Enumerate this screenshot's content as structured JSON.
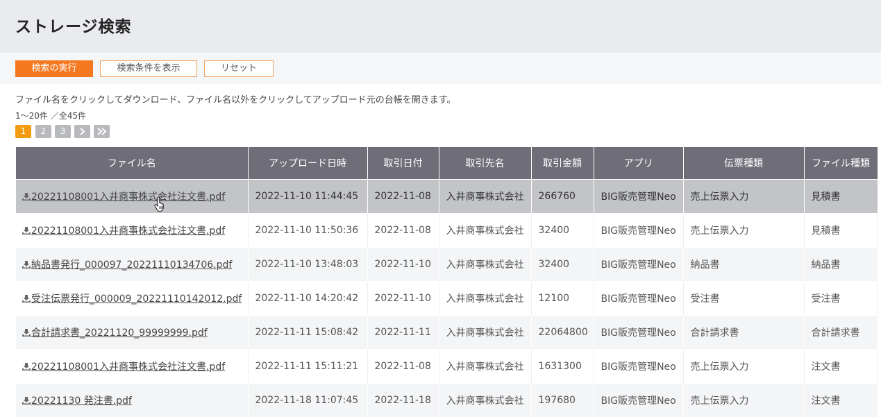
{
  "page": {
    "title": "ストレージ検索"
  },
  "toolbar": {
    "execute_label": "検索の実行",
    "show_conditions_label": "検索条件を表示",
    "reset_label": "リセット"
  },
  "description": "ファイル名をクリックしてダウンロード、ファイル名以外をクリックしてアップロード元の台帳を開きます。",
  "result_count": "1〜20件 ／全45件",
  "pagination": {
    "pages": [
      "1",
      "2",
      "3"
    ],
    "current": "1",
    "next_icon": "chevron-right-icon",
    "last_icon": "double-chevron-right-icon"
  },
  "table": {
    "columns": [
      "ファイル名",
      "アップロード日時",
      "取引日付",
      "取引先名",
      "取引金額",
      "アプリ",
      "伝票種類",
      "ファイル種類"
    ],
    "rows": [
      {
        "file": "20221108001入井商事株式会社注文書.pdf",
        "uploaded": "2022-11-10 11:44:45",
        "date": "2022-11-08",
        "partner": "入井商事株式会社",
        "amount": "266760",
        "app": "BIG販売管理Neo",
        "slip": "売上伝票入力",
        "ftype": "見積書"
      },
      {
        "file": "20221108001入井商事株式会社注文書.pdf",
        "uploaded": "2022-11-10 11:50:36",
        "date": "2022-11-08",
        "partner": "入井商事株式会社",
        "amount": "32400",
        "app": "BIG販売管理Neo",
        "slip": "売上伝票入力",
        "ftype": "見積書"
      },
      {
        "file": "納品書発行_000097_20221110134706.pdf",
        "uploaded": "2022-11-10 13:48:03",
        "date": "2022-11-10",
        "partner": "入井商事株式会社",
        "amount": "32400",
        "app": "BIG販売管理Neo",
        "slip": "納品書",
        "ftype": "納品書"
      },
      {
        "file": "受注伝票発行_000009_20221110142012.pdf",
        "uploaded": "2022-11-10 14:20:42",
        "date": "2022-11-10",
        "partner": "入井商事株式会社",
        "amount": "12100",
        "app": "BIG販売管理Neo",
        "slip": "受注書",
        "ftype": "受注書"
      },
      {
        "file": "合計請求書_20221120_99999999.pdf",
        "uploaded": "2022-11-11 15:08:42",
        "date": "2022-11-11",
        "partner": "入井商事株式会社",
        "amount": "22064800",
        "app": "BIG販売管理Neo",
        "slip": "合計請求書",
        "ftype": "合計請求書"
      },
      {
        "file": "20221108001入井商事株式会社注文書.pdf",
        "uploaded": "2022-11-11 15:11:21",
        "date": "2022-11-08",
        "partner": "入井商事株式会社",
        "amount": "1631300",
        "app": "BIG販売管理Neo",
        "slip": "売上伝票入力",
        "ftype": "注文書"
      },
      {
        "file": "20221130 発注書.pdf",
        "uploaded": "2022-11-18 11:07:45",
        "date": "2022-11-18",
        "partner": "入井商事株式会社",
        "amount": "197680",
        "app": "BIG販売管理Neo",
        "slip": "売上伝票入力",
        "ftype": "注文書"
      }
    ]
  },
  "colors": {
    "accent": "#f47920",
    "page_active": "#f39c12",
    "header_bg": "#6f6e78",
    "hover_row": "#c2c4c8"
  }
}
